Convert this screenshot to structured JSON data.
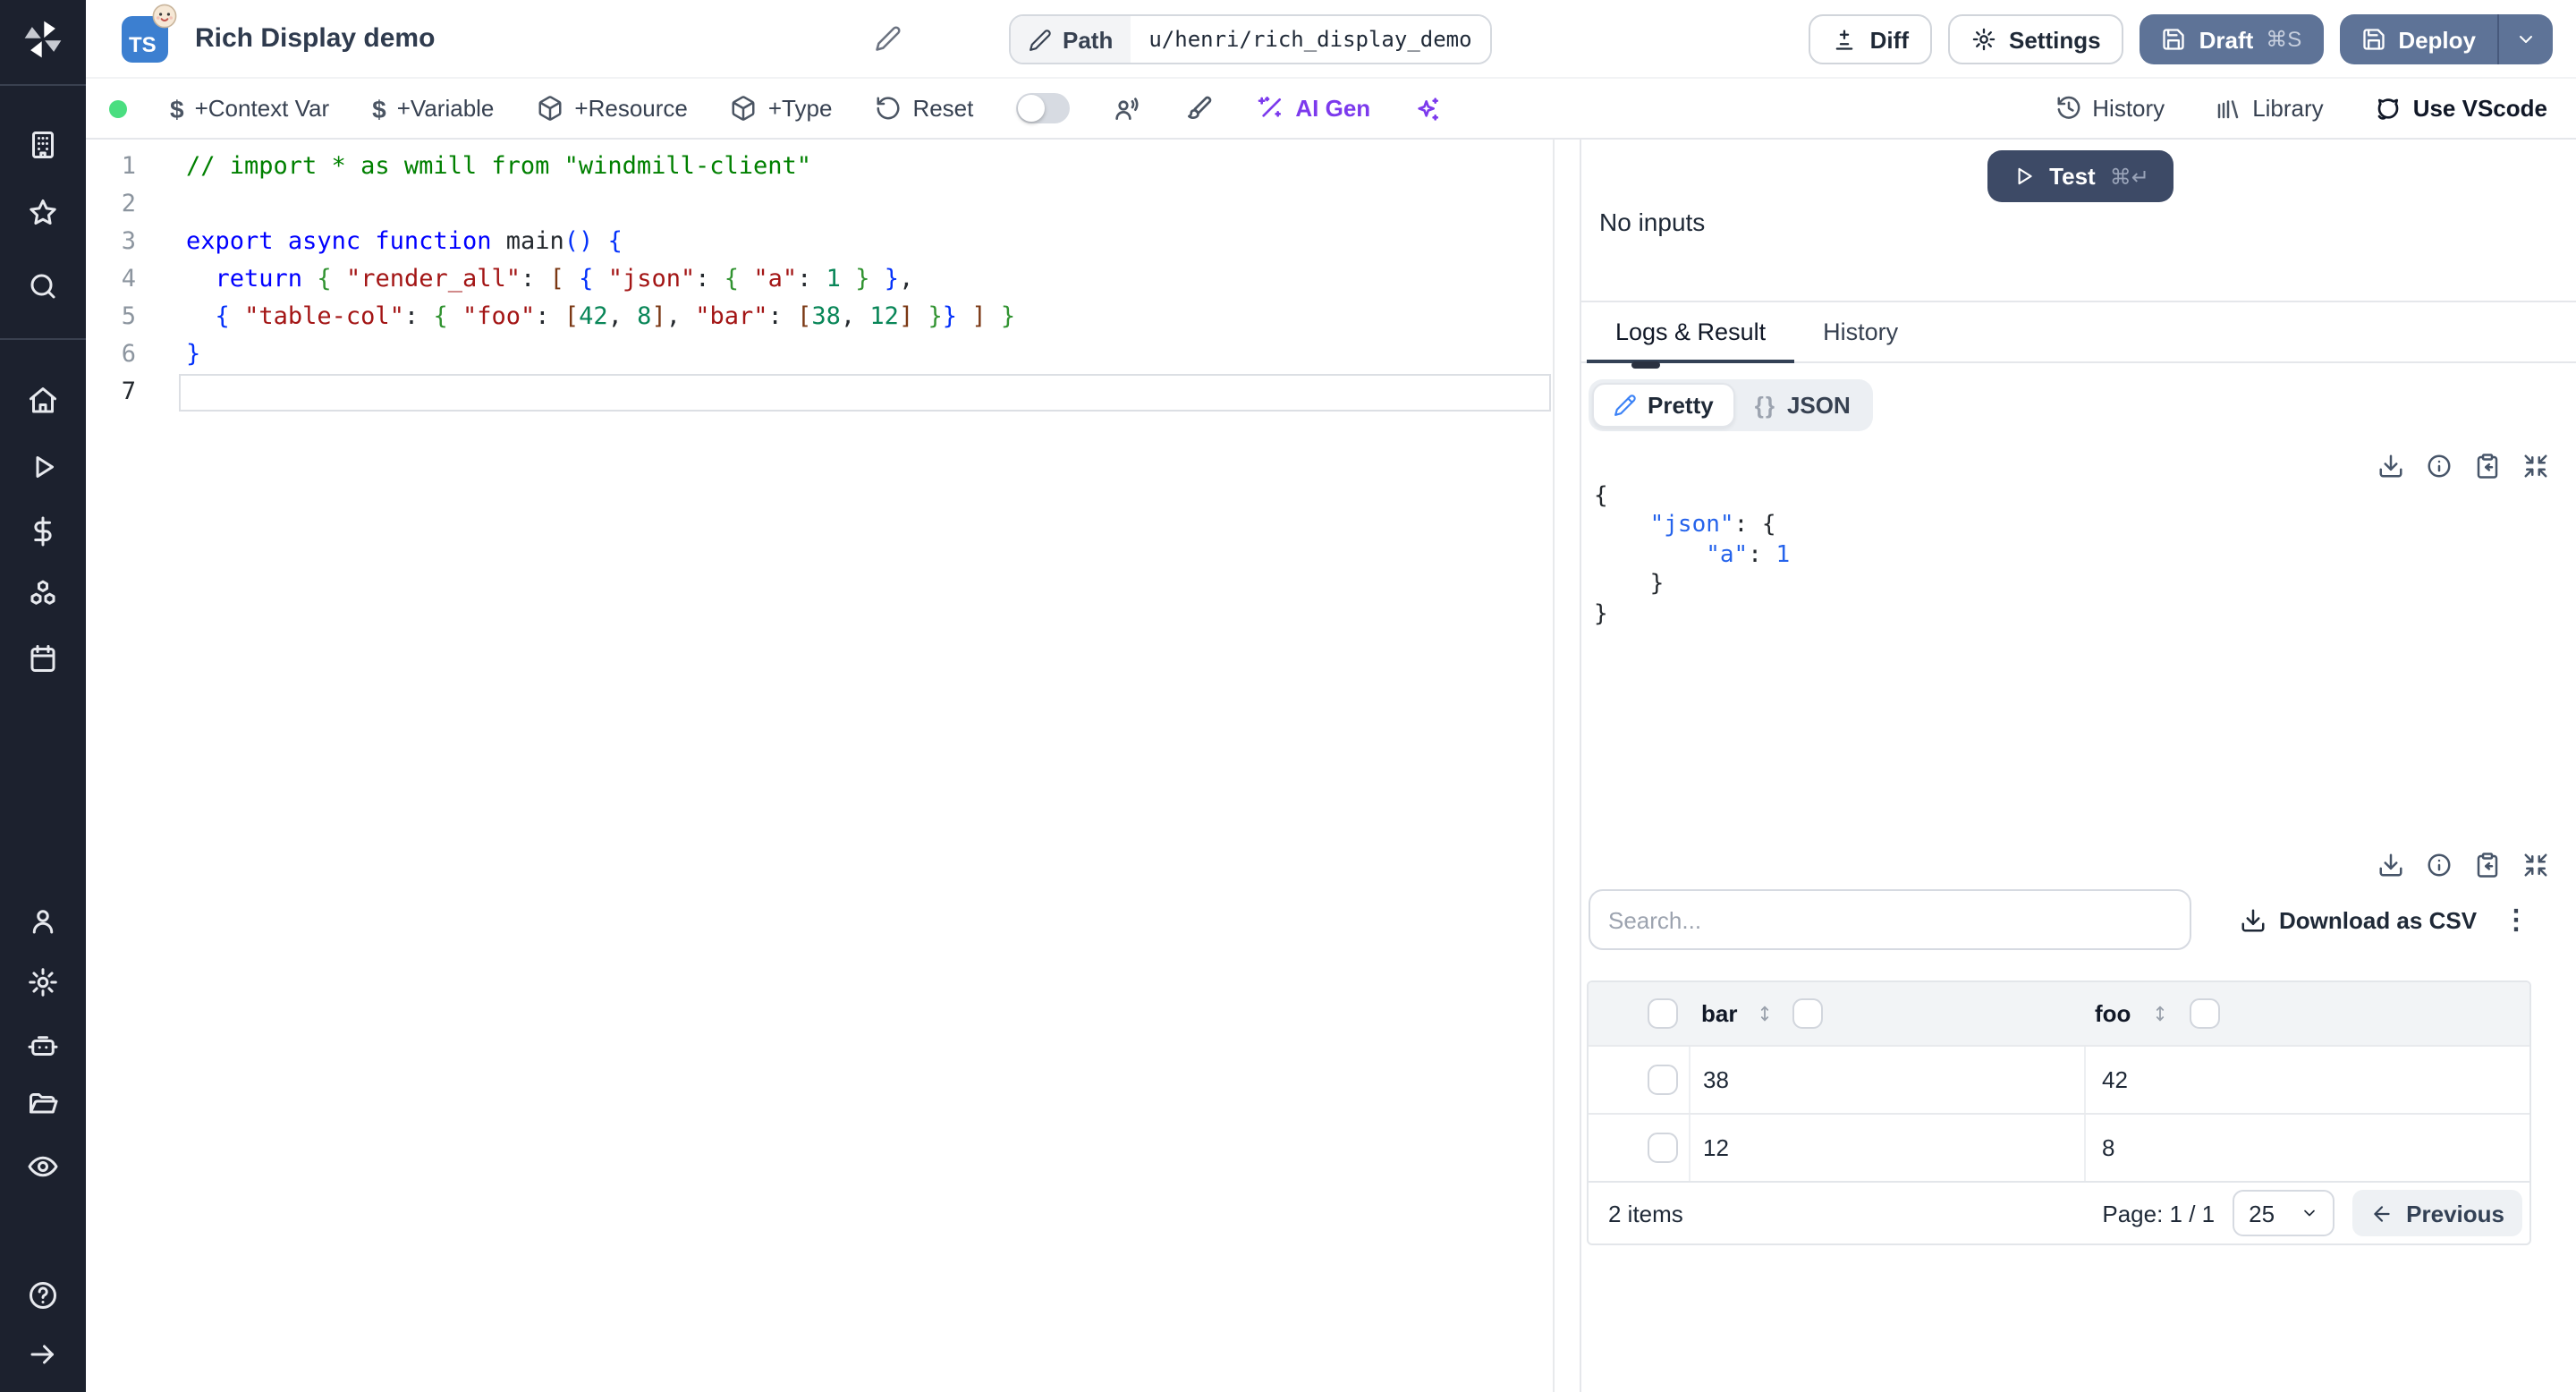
{
  "colors": {
    "sidebar_bg": "#1c212e",
    "slate_button": "#5e7397",
    "dark_button": "#3d4a66",
    "ai_accent": "#7c3aed",
    "status_green": "#4ade80",
    "json_blue": "#2563eb"
  },
  "sidebar": {
    "icons": [
      "windmill-logo",
      "workspace",
      "favorites",
      "search",
      "home",
      "runs",
      "variables",
      "resources",
      "schedules",
      "users",
      "settings",
      "workers",
      "folders",
      "audit-logs",
      "help",
      "expand"
    ]
  },
  "header": {
    "language_badge": "TS",
    "title": "Rich Display demo",
    "path_label": "Path",
    "path_value": "u/henri/rich_display_demo",
    "diff": "Diff",
    "settings": "Settings",
    "draft": "Draft",
    "draft_shortcut": "⌘S",
    "deploy": "Deploy"
  },
  "toolbar": {
    "context_var": "+Context Var",
    "variable": "+Variable",
    "resource": "+Resource",
    "type": "+Type",
    "reset": "Reset",
    "ai_gen": "AI Gen",
    "history": "History",
    "library": "Library",
    "vscode": "Use VScode"
  },
  "editor": {
    "lines": [
      {
        "n": "1",
        "t": [
          [
            "cm",
            "// import * as wmill from \"windmill-client\""
          ]
        ]
      },
      {
        "n": "2",
        "t": []
      },
      {
        "n": "3",
        "t": [
          [
            "kw",
            "export"
          ],
          [
            "pl",
            " "
          ],
          [
            "kw",
            "async"
          ],
          [
            "pl",
            " "
          ],
          [
            "kw",
            "function"
          ],
          [
            "pl",
            " "
          ],
          [
            "fn",
            "main"
          ],
          [
            "b1",
            "()"
          ],
          [
            "pl",
            " "
          ],
          [
            "b1",
            "{"
          ]
        ]
      },
      {
        "n": "4",
        "t": [
          [
            "pl",
            "  "
          ],
          [
            "kw",
            "return"
          ],
          [
            "pl",
            " "
          ],
          [
            "b2",
            "{"
          ],
          [
            "pl",
            " "
          ],
          [
            "st",
            "\"render_all\""
          ],
          [
            "pl",
            ": "
          ],
          [
            "b3",
            "["
          ],
          [
            "pl",
            " "
          ],
          [
            "b1",
            "{"
          ],
          [
            "pl",
            " "
          ],
          [
            "st",
            "\"json\""
          ],
          [
            "pl",
            ": "
          ],
          [
            "b2",
            "{"
          ],
          [
            "pl",
            " "
          ],
          [
            "st",
            "\"a\""
          ],
          [
            "pl",
            ": "
          ],
          [
            "nu",
            "1"
          ],
          [
            "pl",
            " "
          ],
          [
            "b2",
            "}"
          ],
          [
            "pl",
            " "
          ],
          [
            "b1",
            "}"
          ],
          [
            "pl",
            ","
          ]
        ]
      },
      {
        "n": "5",
        "t": [
          [
            "pl",
            "  "
          ],
          [
            "b1",
            "{"
          ],
          [
            "pl",
            " "
          ],
          [
            "st",
            "\"table-col\""
          ],
          [
            "pl",
            ": "
          ],
          [
            "b2",
            "{"
          ],
          [
            "pl",
            " "
          ],
          [
            "st",
            "\"foo\""
          ],
          [
            "pl",
            ": "
          ],
          [
            "b3",
            "["
          ],
          [
            "nu",
            "42"
          ],
          [
            "pl",
            ", "
          ],
          [
            "nu",
            "8"
          ],
          [
            "b3",
            "]"
          ],
          [
            "pl",
            ", "
          ],
          [
            "st",
            "\"bar\""
          ],
          [
            "pl",
            ": "
          ],
          [
            "b3",
            "["
          ],
          [
            "nu",
            "38"
          ],
          [
            "pl",
            ", "
          ],
          [
            "nu",
            "12"
          ],
          [
            "b3",
            "]"
          ],
          [
            "pl",
            " "
          ],
          [
            "b2",
            "}"
          ],
          [
            "b1",
            "}"
          ],
          [
            "pl",
            " "
          ],
          [
            "b3",
            "]"
          ],
          [
            "pl",
            " "
          ],
          [
            "b2",
            "}"
          ]
        ]
      },
      {
        "n": "6",
        "t": [
          [
            "b1",
            "}"
          ]
        ]
      },
      {
        "n": "7",
        "t": []
      }
    ]
  },
  "run": {
    "test": "Test",
    "test_shortcut": "⌘↵",
    "no_inputs": "No inputs"
  },
  "tabs": {
    "logs": "Logs & Result",
    "history": "History"
  },
  "result": {
    "pretty": "Pretty",
    "json_braces": "{}",
    "json_label": "JSON",
    "lines": [
      [
        [
          "pl",
          "{"
        ]
      ],
      [
        [
          "pl",
          "    "
        ],
        [
          "key",
          "\"json\""
        ],
        [
          "pl",
          ": {"
        ]
      ],
      [
        [
          "pl",
          "        "
        ],
        [
          "key",
          "\"a\""
        ],
        [
          "pl",
          ": "
        ],
        [
          "num",
          "1"
        ]
      ],
      [
        [
          "pl",
          "    }"
        ]
      ],
      [
        [
          "pl",
          "}"
        ]
      ]
    ]
  },
  "table": {
    "search_placeholder": "Search...",
    "download_csv": "Download as CSV",
    "columns": [
      "bar",
      "foo"
    ],
    "rows": [
      [
        "38",
        "42"
      ],
      [
        "12",
        "8"
      ]
    ],
    "items_count": "2 items",
    "page": "Page: 1 / 1",
    "page_size": "25",
    "previous": "Previous"
  }
}
